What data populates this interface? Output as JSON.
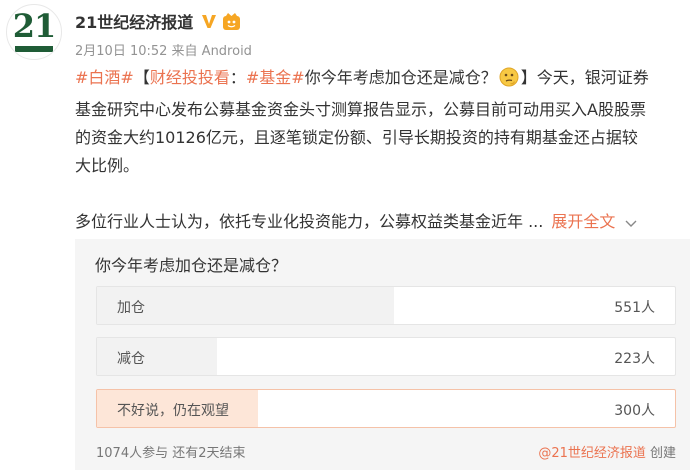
{
  "post": {
    "author": "21世纪经济报道",
    "avatar_text": "21",
    "meta": "2月10日 10:52 来自 Android",
    "line1": {
      "tag_liquor": "#白酒#",
      "bracket_open": "【",
      "column": "财经投投看",
      "colon": "：",
      "tag_fund": "#基金#",
      "question": "你今年考虑加仓还是减仓？",
      "emoji": "thinking-face",
      "rest": "】今天，银河证券"
    },
    "line2": "基金研究中心发布公募基金资金头寸测算报告显示，公募目前可动用买入A股股票",
    "line3": "的资金大约10126亿元，且逐笔锁定份额、引导长期投资的持有期基金还占据较",
    "line4": "大比例。",
    "line5": "多位行业人士认为，依托专业化投资能力，公募权益类基金近年 ...",
    "expand_label": "展开全文"
  },
  "poll": {
    "question": "你今年考虑加仓还是减仓？",
    "options": [
      {
        "label": "加仓",
        "count": "551人",
        "votes": 551,
        "selected": false
      },
      {
        "label": "减仓",
        "count": "223人",
        "votes": 223,
        "selected": false
      },
      {
        "label": "不好说，仍在观望",
        "count": "300人",
        "votes": 300,
        "selected": true
      }
    ],
    "footer": "1074人参与 还有2天结束",
    "creator": "@21世纪经济报道",
    "creator_suffix": " 创建"
  },
  "colors": {
    "link": "#eb7350",
    "verified": "#f6a623",
    "logo_green": "#1f5c36"
  }
}
